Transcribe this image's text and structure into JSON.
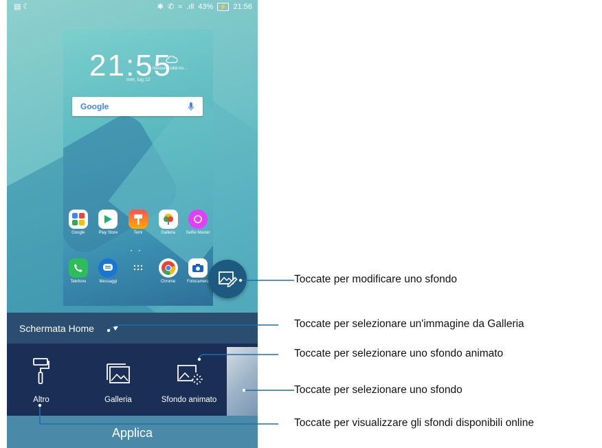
{
  "status_bar": {
    "battery": "43%",
    "time": "21:56"
  },
  "preview": {
    "clock": "21:55",
    "date": "mer, lug 12",
    "weather": "Nessuna città tro...",
    "google_logo": "Google",
    "apps_row1": [
      "Google",
      "Play Store",
      "Temi",
      "Galleria",
      "Selfie Master"
    ],
    "apps_row2": [
      "Telefono",
      "Messaggi",
      "",
      "Chrome",
      "Fotocamera"
    ]
  },
  "wallpaper_menu": {
    "home_label": "Schermata Home",
    "options": [
      "Altro",
      "Galleria",
      "Sfondo animato"
    ],
    "apply_label": "Applica"
  },
  "callouts": [
    "Toccate per modificare uno sfondo",
    "Toccate per selezionare un'immagine da Galleria",
    "Toccate per selezionare uno sfondo animato",
    "Toccate per selezionare uno sfondo",
    "Toccate per visualizzare gli sfondi disponibili online"
  ]
}
